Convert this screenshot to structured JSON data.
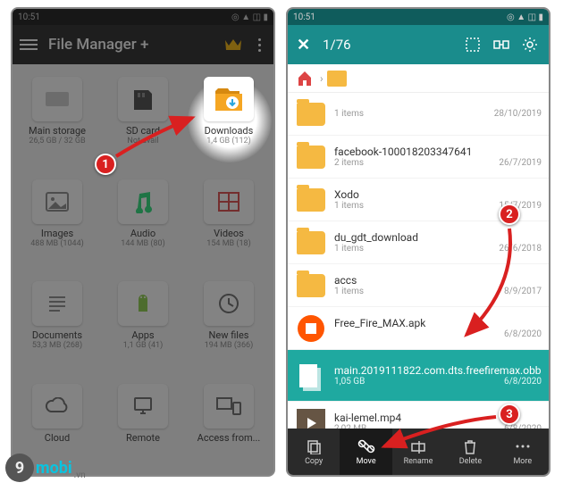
{
  "status": {
    "time": "10:51"
  },
  "left": {
    "title": "File Manager +",
    "grid": [
      {
        "label": "Main storage",
        "sub": "26,5 GB / 32 GB",
        "icon": "storage"
      },
      {
        "label": "SD card",
        "sub": "Not avail",
        "icon": "sdcard"
      },
      {
        "label": "Downloads",
        "sub": "1,4 GB (112)",
        "icon": "downloads"
      },
      {
        "label": "Images",
        "sub": "488 MB (1044)",
        "icon": "image"
      },
      {
        "label": "Audio",
        "sub": "144 MB (80)",
        "icon": "audio"
      },
      {
        "label": "Videos",
        "sub": "154 MB (18)",
        "icon": "video"
      },
      {
        "label": "Documents",
        "sub": "53,3 MB (268)",
        "icon": "doc"
      },
      {
        "label": "Apps",
        "sub": "1,1 GB (41)",
        "icon": "apps"
      },
      {
        "label": "New files",
        "sub": "194 MB (366)",
        "icon": "clock"
      },
      {
        "label": "Cloud",
        "sub": "",
        "icon": "cloud"
      },
      {
        "label": "Remote",
        "sub": "",
        "icon": "remote"
      },
      {
        "label": "Access from...",
        "sub": "",
        "icon": "access"
      }
    ]
  },
  "right": {
    "selection_count": "1/76",
    "files": [
      {
        "name": "",
        "items": "1 items",
        "date": "28/10/2019",
        "type": "folder"
      },
      {
        "name": "facebook-100018203347641",
        "items": "2 items",
        "date": "26/7/2019",
        "type": "folder"
      },
      {
        "name": "Xodo",
        "items": "1 items",
        "date": "15/7/2019",
        "type": "folder"
      },
      {
        "name": "du_gdt_download",
        "items": "1 items",
        "date": "26/6/2018",
        "type": "folder"
      },
      {
        "name": "accs",
        "items": "1 items",
        "date": "8/9/2017",
        "type": "folder"
      },
      {
        "name": "Free_Fire_MAX.apk",
        "items": "",
        "date": "6/8/2020",
        "type": "apk"
      },
      {
        "name": "main.2019111822.com.dts.freefiremax.obb",
        "items": "1,05 GB",
        "date": "6/8/2020",
        "type": "obb",
        "selected": true
      },
      {
        "name": "kai-lemel.mp4",
        "items": "2,02 MB",
        "date": "6/8/2020",
        "type": "video"
      }
    ],
    "actions": [
      {
        "label": "Copy",
        "icon": "copy"
      },
      {
        "label": "Move",
        "icon": "move",
        "active": true
      },
      {
        "label": "Rename",
        "icon": "rename"
      },
      {
        "label": "Delete",
        "icon": "delete"
      },
      {
        "label": "More",
        "icon": "more"
      }
    ]
  },
  "markers": {
    "m1": "1",
    "m2": "2",
    "m3": "3"
  },
  "watermark": {
    "nine": "9",
    "mobi": "mobi",
    "vn": ".vn"
  }
}
